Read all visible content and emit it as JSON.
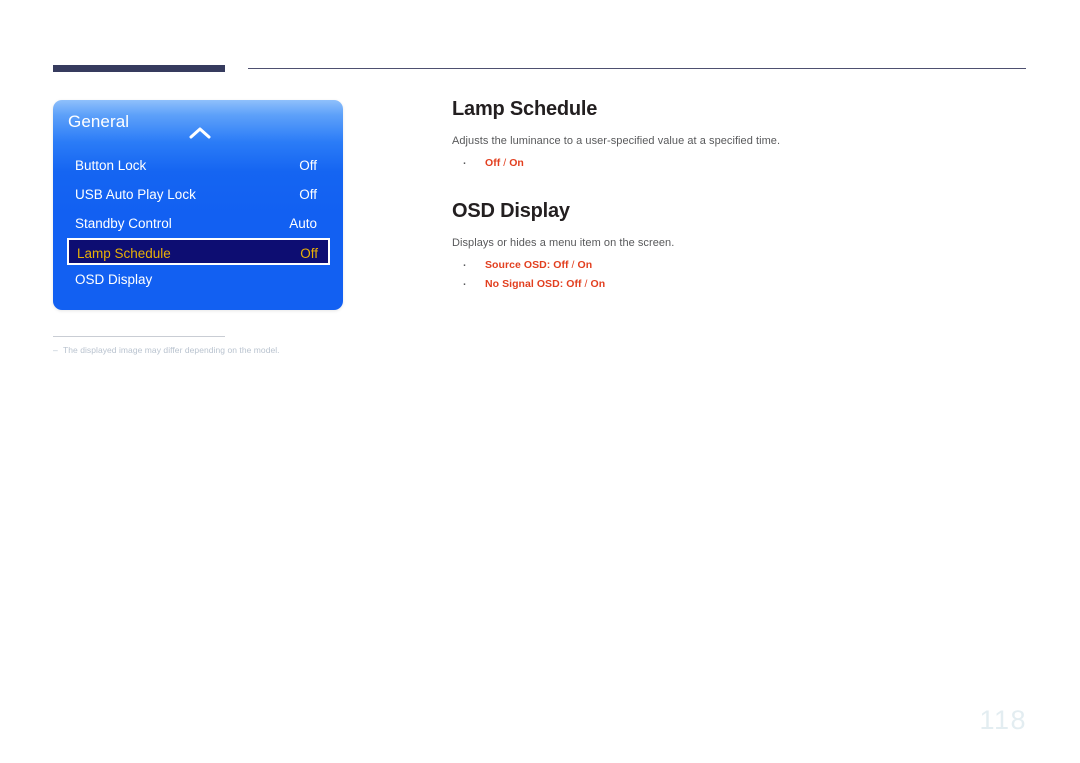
{
  "header": {
    "rule_thick_color": "#363b5e",
    "rule_thin_color": "#4e5070"
  },
  "osd_panel": {
    "title": "General",
    "collapse_icon": "chevron-up-icon",
    "accent_blue": "#1260f2",
    "selected_bg": "#0d0d72",
    "selected_text_color": "#e9b007",
    "items": [
      {
        "label": "Button Lock",
        "value": "Off",
        "selected": false
      },
      {
        "label": "USB Auto Play Lock",
        "value": "Off",
        "selected": false
      },
      {
        "label": "Standby Control",
        "value": "Auto",
        "selected": false
      },
      {
        "label": "Lamp Schedule",
        "value": "Off",
        "selected": true
      },
      {
        "label": "OSD Display",
        "value": "",
        "selected": false
      }
    ]
  },
  "footnote": {
    "dash": "–",
    "text": "The displayed image may differ depending on the model."
  },
  "sections": [
    {
      "title": "Lamp Schedule",
      "description": "Adjusts the luminance to a user-specified value at a specified time.",
      "bullets": [
        {
          "prefix": "Off",
          "sep": " / ",
          "suffix": "On"
        }
      ]
    },
    {
      "title": "OSD Display",
      "description": "Displays or hides a menu item on the screen.",
      "bullets": [
        {
          "prefix": "Source OSD: Off",
          "sep": " / ",
          "suffix": "On"
        },
        {
          "prefix": "No Signal OSD: Off",
          "sep": " / ",
          "suffix": "On"
        }
      ]
    }
  ],
  "page_number": "118",
  "colors": {
    "heading": "#231f20",
    "body": "#58595b",
    "bullet_red": "#e23f1f",
    "page_number": "#e3edf1"
  }
}
